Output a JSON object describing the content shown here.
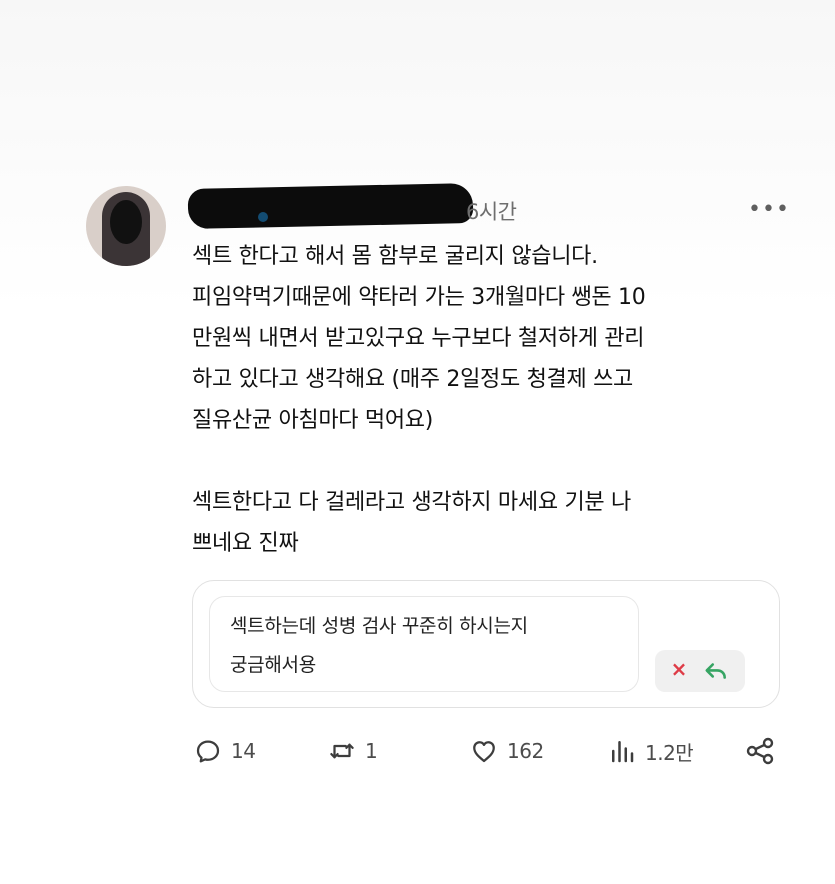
{
  "post": {
    "timestamp": "6시간",
    "text": "섹트 한다고 해서 몸 함부로 굴리지 않습니다.\n피임약먹기때문에 약타러 가는 3개월마다 쌩돈 10\n만원씩 내면서 받고있구요 누구보다 철저하게 관리\n하고 있다고 생각해요 (매주 2일정도 청결제 쓰고\n질유산균 아침마다 먹어요)\n\n섹트한다고 다 걸레라고 생각하지 마세요 기분 나\n쁘네요 진짜"
  },
  "reply_preview": {
    "text": "섹트하는데 성병 검사 꾸준히 하시는지\n궁금해서용"
  },
  "metrics": {
    "replies": "14",
    "reposts": "1",
    "likes": "162",
    "views": "1.2만"
  },
  "icons": {
    "more": "more-icon",
    "reply": "reply-icon",
    "repost": "repost-icon",
    "like": "heart-icon",
    "views": "views-icon",
    "share": "share-icon",
    "dismiss": "close-icon",
    "send": "reply-arrow-icon"
  },
  "colors": {
    "background": "#ffffff",
    "text": "#111111",
    "muted": "#6e6e6e",
    "dismiss": "#de3c47",
    "send": "#36a463"
  }
}
